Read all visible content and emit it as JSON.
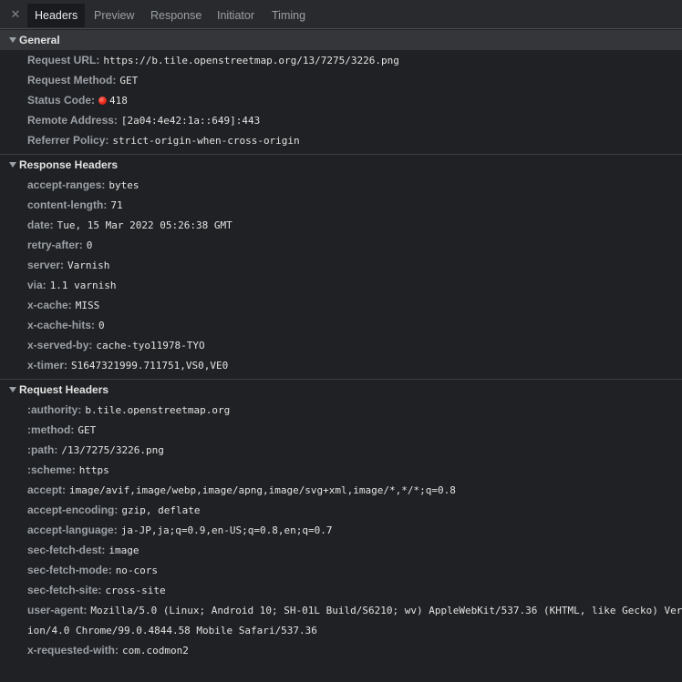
{
  "tabs": [
    {
      "label": "Headers",
      "active": true
    },
    {
      "label": "Preview",
      "active": false
    },
    {
      "label": "Response",
      "active": false
    },
    {
      "label": "Initiator",
      "active": false
    },
    {
      "label": "Timing",
      "active": false
    }
  ],
  "general": {
    "title": "General",
    "request_url_label": "Request URL:",
    "request_url": "https://b.tile.openstreetmap.org/13/7275/3226.png",
    "request_method_label": "Request Method:",
    "request_method": "GET",
    "status_code_label": "Status Code:",
    "status_code": "418",
    "status_color": "#e8281a",
    "remote_address_label": "Remote Address:",
    "remote_address": "[2a04:4e42:1a::649]:443",
    "referrer_policy_label": "Referrer Policy:",
    "referrer_policy": "strict-origin-when-cross-origin"
  },
  "response_headers": {
    "title": "Response Headers",
    "items": [
      {
        "name": "accept-ranges:",
        "value": "bytes"
      },
      {
        "name": "content-length:",
        "value": "71"
      },
      {
        "name": "date:",
        "value": "Tue, 15 Mar 2022 05:26:38 GMT"
      },
      {
        "name": "retry-after:",
        "value": "0"
      },
      {
        "name": "server:",
        "value": "Varnish"
      },
      {
        "name": "via:",
        "value": "1.1 varnish"
      },
      {
        "name": "x-cache:",
        "value": "MISS"
      },
      {
        "name": "x-cache-hits:",
        "value": "0"
      },
      {
        "name": "x-served-by:",
        "value": "cache-tyo11978-TYO"
      },
      {
        "name": "x-timer:",
        "value": "S1647321999.711751,VS0,VE0"
      }
    ]
  },
  "request_headers": {
    "title": "Request Headers",
    "items": [
      {
        "name": ":authority:",
        "value": "b.tile.openstreetmap.org"
      },
      {
        "name": ":method:",
        "value": "GET"
      },
      {
        "name": ":path:",
        "value": "/13/7275/3226.png"
      },
      {
        "name": ":scheme:",
        "value": "https"
      },
      {
        "name": "accept:",
        "value": "image/avif,image/webp,image/apng,image/svg+xml,image/*,*/*;q=0.8"
      },
      {
        "name": "accept-encoding:",
        "value": "gzip, deflate"
      },
      {
        "name": "accept-language:",
        "value": "ja-JP,ja;q=0.9,en-US;q=0.8,en;q=0.7"
      },
      {
        "name": "sec-fetch-dest:",
        "value": "image"
      },
      {
        "name": "sec-fetch-mode:",
        "value": "no-cors"
      },
      {
        "name": "sec-fetch-site:",
        "value": "cross-site"
      }
    ],
    "user_agent_label": "user-agent:",
    "user_agent_line1": "Mozilla/5.0 (Linux; Android 10; SH-01L Build/S6210; wv) AppleWebKit/537.36 (KHTML, like Gecko) Ver",
    "user_agent_line2": "ion/4.0 Chrome/99.0.4844.58 Mobile Safari/537.36",
    "x_requested_with_label": "x-requested-with:",
    "x_requested_with": "com.codmon2"
  }
}
